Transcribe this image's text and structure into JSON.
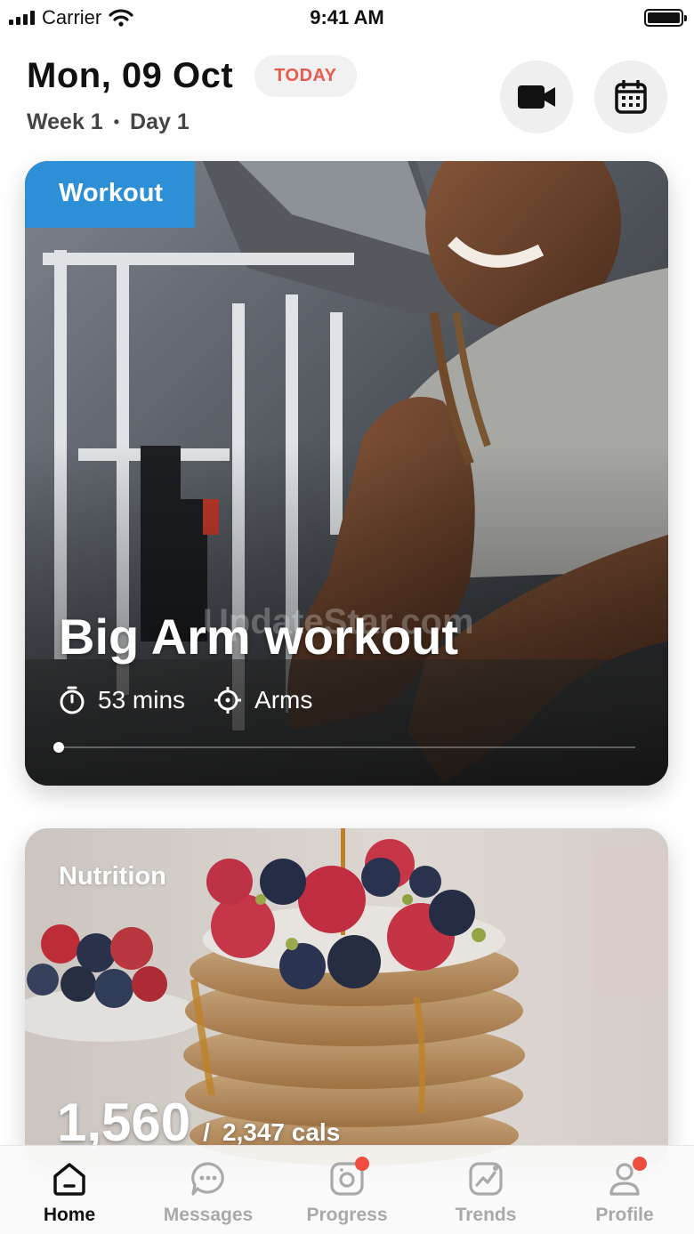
{
  "status_bar": {
    "carrier": "Carrier",
    "time": "9:41 AM"
  },
  "header": {
    "date": "Mon, 09 Oct",
    "badge": "TODAY",
    "week": "Week 1",
    "separator": "•",
    "day": "Day 1",
    "icons": [
      "video-camera-icon",
      "calendar-icon"
    ]
  },
  "workout_card": {
    "tag": "Workout",
    "title": "Big Arm workout",
    "watermark": "UpdateStar.com",
    "duration": "53 mins",
    "target": "Arms",
    "progress": 0
  },
  "nutrition_card": {
    "tag": "Nutrition",
    "consumed": "1,560",
    "separator": "/",
    "total": "2,347 cals"
  },
  "tabs": [
    {
      "label": "Home",
      "icon": "home-icon",
      "active": true,
      "badge": false
    },
    {
      "label": "Messages",
      "icon": "messages-icon",
      "active": false,
      "badge": false
    },
    {
      "label": "Progress",
      "icon": "progress-camera-icon",
      "active": false,
      "badge": true
    },
    {
      "label": "Trends",
      "icon": "trends-icon",
      "active": false,
      "badge": false
    },
    {
      "label": "Profile",
      "icon": "profile-icon",
      "active": false,
      "badge": true
    }
  ],
  "colors": {
    "accent_red": "#e85a4f",
    "workout_blue": "#2d8fd6",
    "notification": "#ee4d3f"
  }
}
